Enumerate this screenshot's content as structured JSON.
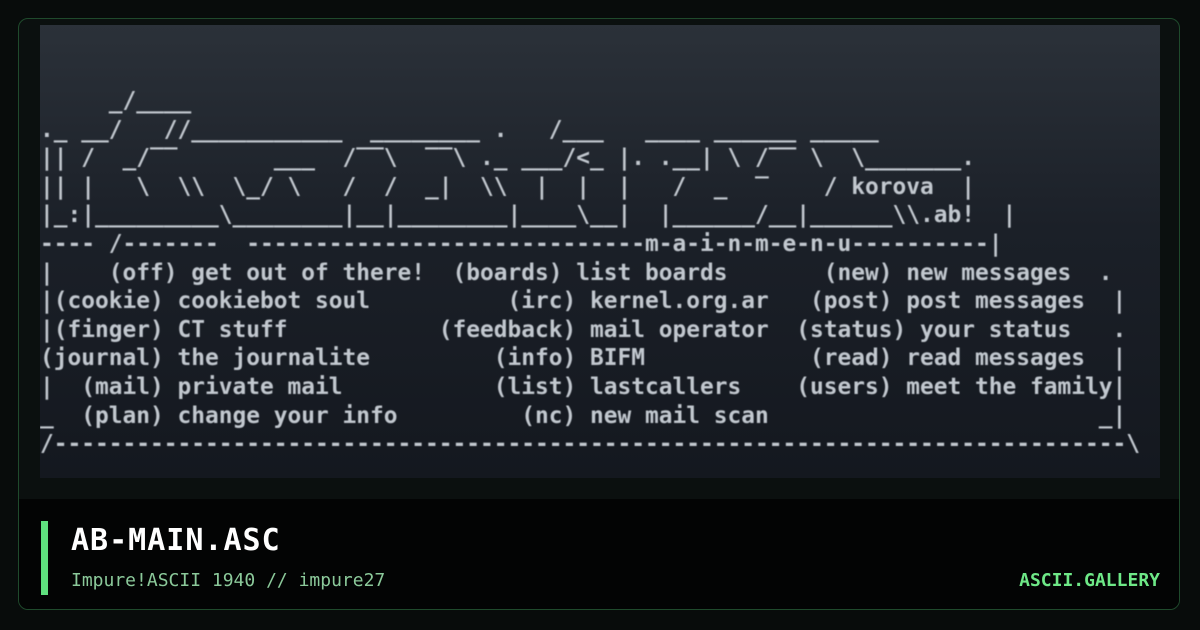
{
  "art": {
    "lines": [
      "     _/____     ",
      "._ __/   //___________  ________ .   /___   ____ ______ _____",
      "|| /  _/‾‾       ___  /‾‾\\  ‾‾\\ ._ ___/<_ |. .__| \\ /‾‾ \\  \\_______.",
      "|| |   \\  \\\\  \\_/ \\   /  /  _|  \\\\  |  |  |   /  _  ‾    / korova  |",
      "|_:|_________\\________|__|________|____\\__|  |______/__|______\\\\.ab!  |",
      "---- /-------  -----------------------------m-a-i-n-m-e-n-u----------|",
      "|    (off) get out of there!  (boards) list boards       (new) new messages  .",
      "|(cookie) cookiebot soul          (irc) kernel.org.ar   (post) post messages  |",
      "|(finger) CT stuff           (feedback) mail operator  (status) your status   .",
      "(journal) the journalite         (info) BIFM            (read) read messages  |",
      "|  (mail) private mail           (list) lastcallers    (users) meet the family|",
      "_  (plan) change your info         (nc) new mail scan                        _|",
      "/------------------------------------------------------------------------------\\"
    ]
  },
  "footer": {
    "title": "AB-MAIN.ASC",
    "subtitle": "Impure!ASCII 1940 // impure27",
    "brand": "ASCII.GALLERY"
  },
  "colors": {
    "accent": "#5fe07e",
    "brand": "#6ee887",
    "subtitle": "#8bc99a",
    "art_text": "#c2c8cf",
    "card_border": "#1f4a2c"
  }
}
